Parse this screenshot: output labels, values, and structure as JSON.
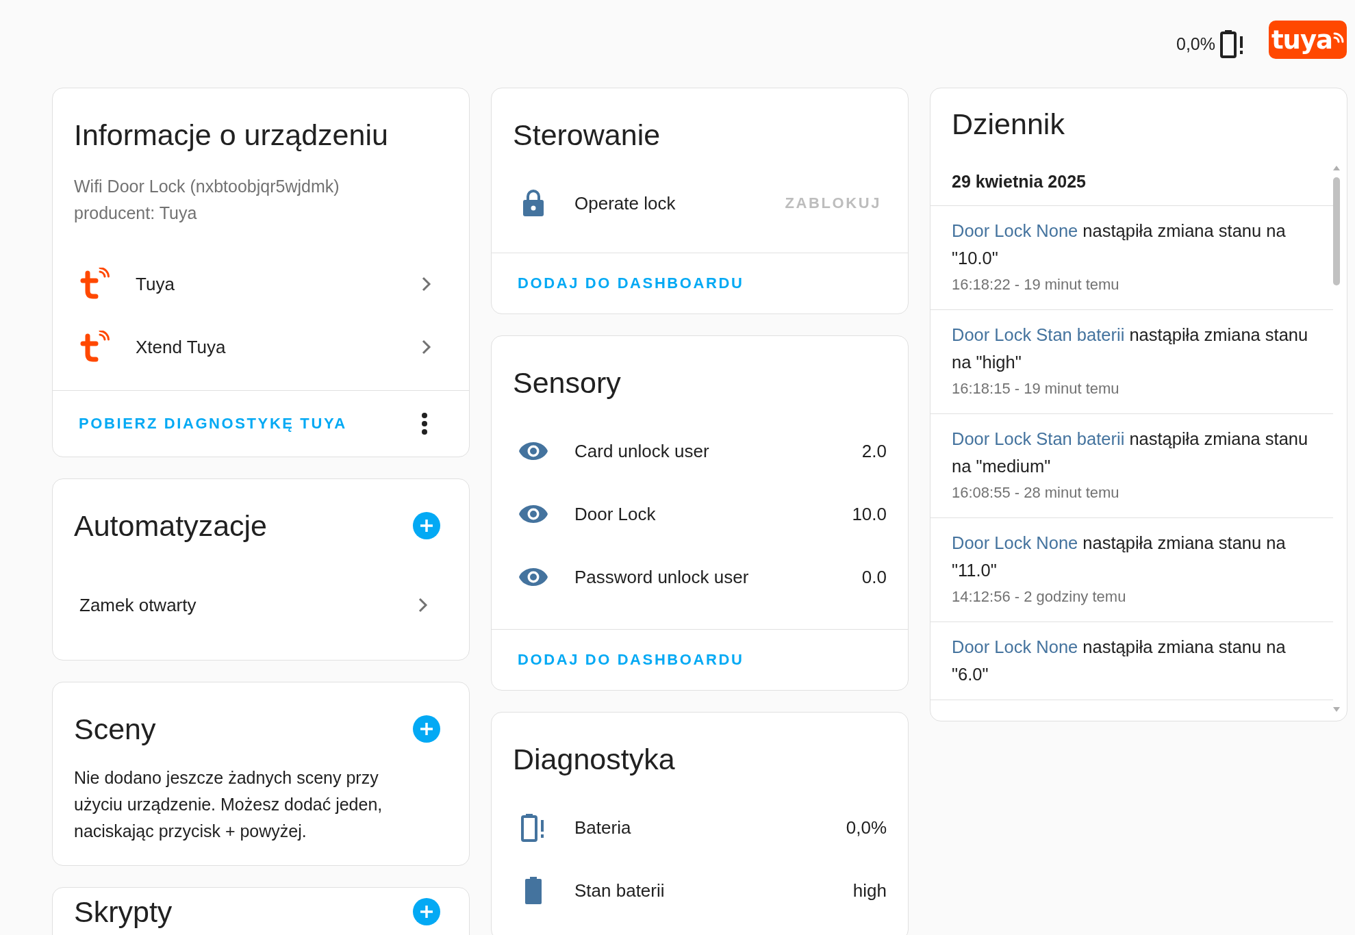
{
  "header": {
    "battery": "0,0%",
    "logo": "tuya"
  },
  "device_info": {
    "title": "Informacje o urządzeniu",
    "model": "Wifi Door Lock (nxbtoobjqr5wjdmk)",
    "manufacturer": "producent: Tuya",
    "integrations": [
      {
        "name": "Tuya"
      },
      {
        "name": "Xtend Tuya"
      }
    ],
    "action": "POBIERZ DIAGNOSTYKĘ TUYA"
  },
  "automations": {
    "title": "Automatyzacje",
    "items": [
      {
        "name": "Zamek otwarty"
      }
    ]
  },
  "scenes": {
    "title": "Sceny",
    "empty_text": "Nie dodano jeszcze żadnych sceny przy użyciu urządzenie. Możesz dodać jeden, naciskając przycisk + powyżej."
  },
  "scripts": {
    "title": "Skrypty"
  },
  "controls": {
    "title": "Sterowanie",
    "entities": [
      {
        "kind": "lock",
        "name": "Operate lock",
        "action": "ZABLOKUJ",
        "disabled": true
      }
    ],
    "action": "DODAJ DO DASHBOARDU"
  },
  "sensors": {
    "title": "Sensory",
    "entities": [
      {
        "kind": "eye",
        "name": "Card unlock user",
        "value": "2.0"
      },
      {
        "kind": "eye",
        "name": "Door Lock",
        "value": "10.0"
      },
      {
        "kind": "eye",
        "name": "Password unlock user",
        "value": "0.0"
      }
    ],
    "action": "DODAJ DO DASHBOARDU"
  },
  "diagnostics": {
    "title": "Diagnostyka",
    "entities": [
      {
        "kind": "battery-alert",
        "name": "Bateria",
        "value": "0,0%"
      },
      {
        "kind": "battery",
        "name": "Stan baterii",
        "value": "high"
      }
    ]
  },
  "logbook": {
    "title": "Dziennik",
    "date": "29 kwietnia 2025",
    "entries": [
      {
        "entity": "Door Lock None",
        "message": "nastąpiła zmiana stanu na \"10.0\"",
        "time": "16:18:22 - 19 minut temu"
      },
      {
        "entity": "Door Lock Stan baterii",
        "message": "nastąpiła zmiana stanu na \"high\"",
        "time": "16:18:15 - 19 minut temu"
      },
      {
        "entity": "Door Lock Stan baterii",
        "message": "nastąpiła zmiana stanu na \"medium\"",
        "time": "16:08:55 - 28 minut temu"
      },
      {
        "entity": "Door Lock None",
        "message": "nastąpiła zmiana stanu na \"11.0\"",
        "time": "14:12:56 - 2 godziny temu"
      },
      {
        "entity": "Door Lock None",
        "message": "nastąpiła zmiana stanu na \"6.0\""
      }
    ]
  }
}
